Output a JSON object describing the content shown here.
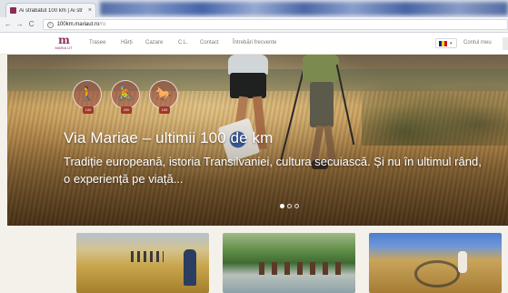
{
  "browser": {
    "tab_title": "Ai străbătut 100 km | Ai str",
    "tab_close": "×",
    "url_domain": "100km.mariaut.ro",
    "url_path": "/ro"
  },
  "site": {
    "logo_mark": "m",
    "logo_text": "MARIA UT",
    "menu": [
      "Trasee",
      "Hărți",
      "Cazare",
      "C.L.",
      "Contact",
      "Întrebări frecvente"
    ],
    "account_label": "Contul meu",
    "flag_colors": [
      "#002b7f",
      "#fcd116",
      "#ce1126"
    ]
  },
  "hero": {
    "title": "Via Mariae – ultimii 100 de km",
    "subtitle": "Tradiție europeană, istoria Transilvaniei, cultura secuiască. Și nu în ultimul rând, o experiență pe viață...",
    "badge_icons": [
      "🚶",
      "🚴",
      "🐎"
    ],
    "badge_tags": [
      "100",
      "200",
      "100"
    ],
    "slides": [
      true,
      false,
      false
    ]
  },
  "cards": [
    {
      "name": "hiking-photo"
    },
    {
      "name": "horse-riding-photo"
    },
    {
      "name": "cycling-photo"
    }
  ]
}
